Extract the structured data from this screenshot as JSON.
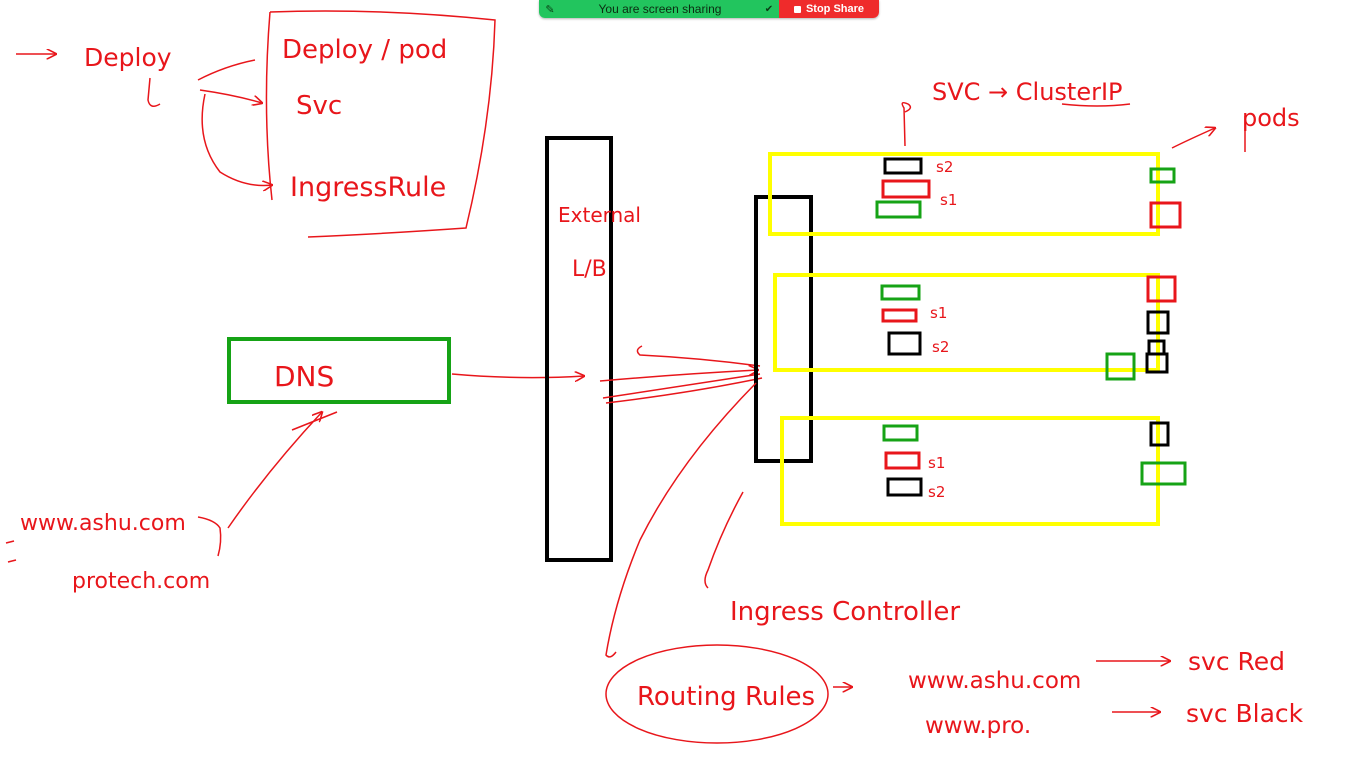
{
  "share_bar": {
    "status_text": "You are screen sharing",
    "stop_label": "Stop Share",
    "colors": {
      "status_bg": "#22c55e",
      "stop_bg": "#ef2b2b"
    },
    "icons": [
      "annotate-icon",
      "shield-check-icon",
      "stop-square-icon"
    ]
  },
  "whiteboard": {
    "ink_color": "#e8161b",
    "box_colors": {
      "dns": "#16a316",
      "load_balancer": "#000000",
      "node": "#ffff00"
    },
    "notes": {
      "deploy": "Deploy",
      "deploy_pod": "Deploy / pod",
      "svc": "Svc",
      "ingress_rule": "IngressRule",
      "external_lb": "External",
      "external_lb_2": "L/B",
      "dns": "DNS",
      "domain_1": "www.ashu.com",
      "domain_2": "protech.com",
      "svc_clusterip": "SVC → ClusterIP",
      "pods": "pods",
      "ingress_controller": "Ingress Controller",
      "routing_rules": "Routing Rules",
      "route_1_host": "www.ashu.com",
      "route_1_target": "svc Red",
      "route_2_host": "www.pro.",
      "route_2_target": "svc Black",
      "s1": "s1",
      "s2": "s2"
    }
  }
}
